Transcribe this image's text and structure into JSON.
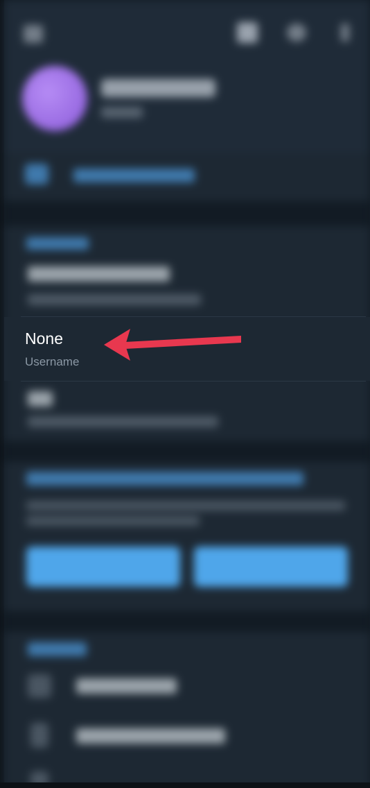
{
  "app": {
    "screen": "profile-settings",
    "accent_color": "#4e9be0",
    "annotation_color": "#e8384f"
  },
  "header": {
    "icons": [
      "menu-icon",
      "qr-code-icon",
      "search-icon",
      "more-icon"
    ]
  },
  "profile": {
    "avatar": "avatar"
  },
  "account": {
    "username": {
      "value": "None",
      "label": "Username"
    }
  },
  "promo": {
    "buttons": [
      "button-1",
      "button-2"
    ]
  },
  "annotation": {
    "type": "arrow",
    "points_to": "username-row"
  }
}
